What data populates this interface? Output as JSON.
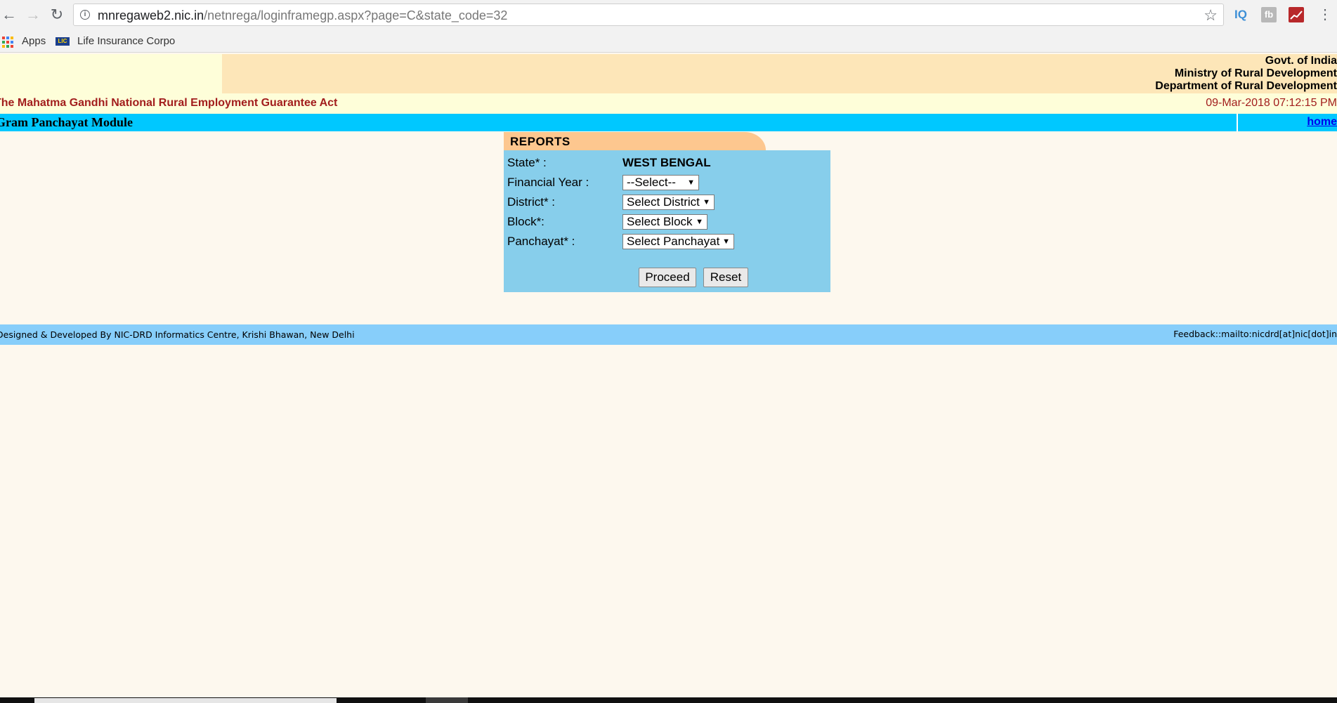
{
  "browser": {
    "url_host": "mnregaweb2.nic.in",
    "url_path": "/netnrega/loginframegp.aspx?page=C&state_code=32",
    "extensions": [
      "IQ",
      "fb"
    ],
    "bookmarks": [
      {
        "label": "Apps",
        "icon": "apps-grid-icon"
      },
      {
        "label": "Life Insurance Corpo",
        "icon": "lic-icon"
      }
    ]
  },
  "header": {
    "gov_lines": [
      "Govt. of India",
      "Ministry of Rural Development",
      "Department of Rural Development"
    ],
    "act_title": "The Mahatma Gandhi National Rural Employment Guarantee Act",
    "datetime": "09-Mar-2018 07:12:15 PM"
  },
  "module": {
    "title": "Gram Panchayat Module",
    "home_link": "home"
  },
  "reports": {
    "tab_label": "REPORTS",
    "state_label": "State* :",
    "state_value": "WEST BENGAL",
    "fy_label": "Financial Year :",
    "fy_value": "--Select--",
    "district_label": "District* :",
    "district_value": "Select District",
    "block_label": "Block*:",
    "block_value": "Select Block",
    "panchayat_label": "Panchayat* :",
    "panchayat_value": "Select Panchayat",
    "proceed_label": "Proceed",
    "reset_label": "Reset"
  },
  "footer": {
    "credit": "Designed & Developed By NIC-DRD Informatics Centre, Krishi Bhawan, New Delhi",
    "feedback": "Feedback::mailto:nicdrd[at]nic[dot]in"
  },
  "colors": {
    "header_peach": "#fde6b8",
    "header_cream": "#fefed9",
    "act_red": "#a21d1d",
    "module_cyan": "#00c8ff",
    "panel_blue": "#87ceeb",
    "tab_orange": "#fdc78f",
    "footer_blue": "#87cefa",
    "page_bg": "#fdf8ee"
  }
}
